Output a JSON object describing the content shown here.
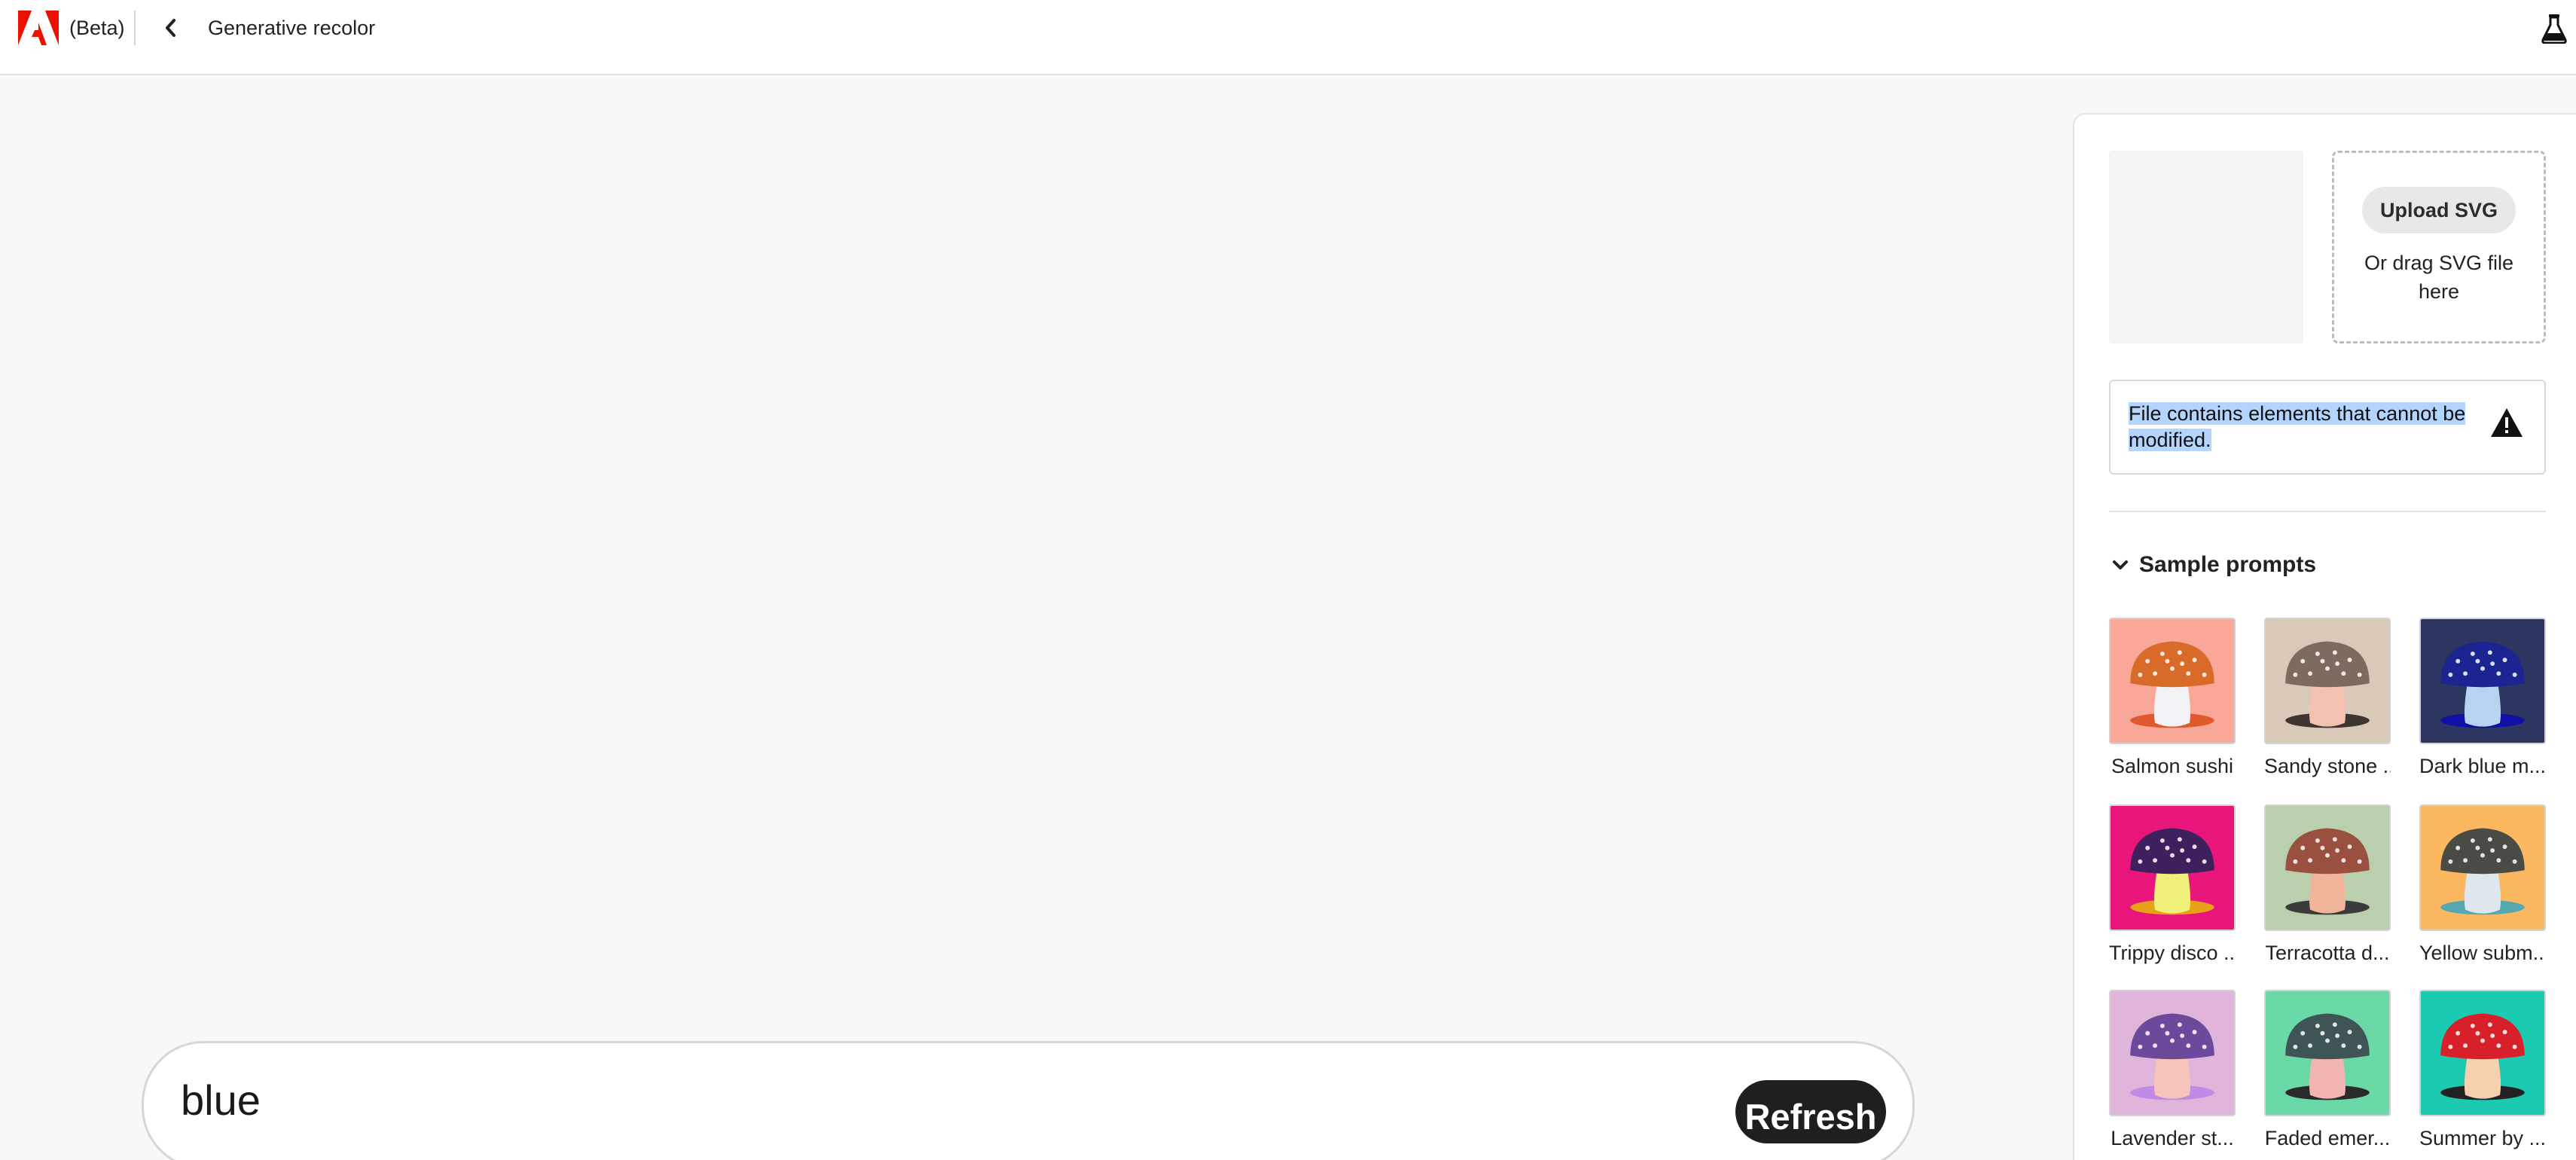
{
  "header": {
    "beta_label": "(Beta)",
    "title": "Generative recolor",
    "back_icon": "chevron-left-icon",
    "labs_icon": "flask-icon",
    "brand_color": "#eb1000"
  },
  "prompt": {
    "value": "blue",
    "refresh_label": "Refresh"
  },
  "panel": {
    "upload_label": "Upload SVG",
    "drag_text": "Or drag SVG file here",
    "alert_text": "File contains elements that cannot be modified.",
    "alert_icon": "warning-icon",
    "section_title": "Sample prompts",
    "samples": [
      {
        "label": "Salmon sushi",
        "bg": "#f9a799",
        "cap": "#d86a2a",
        "stem": "#f2f2f6",
        "shadow": "#e0592c"
      },
      {
        "label": "Sandy stone ...",
        "bg": "#d8c9b8",
        "cap": "#7d6b60",
        "stem": "#f4c1b0",
        "shadow": "#3e3430"
      },
      {
        "label": "Dark blue m...",
        "bg": "#2d3561",
        "cap": "#1b2490",
        "stem": "#b8d2f2",
        "shadow": "#1010a6"
      },
      {
        "label": "Trippy disco ...",
        "bg": "#e8167a",
        "cap": "#3e215c",
        "stem": "#eef07a",
        "shadow": "#e8a21a"
      },
      {
        "label": "Terracotta d...",
        "bg": "#b9cfae",
        "cap": "#9a503e",
        "stem": "#f0b49a",
        "shadow": "#3b3b3b"
      },
      {
        "label": "Yellow subm...",
        "bg": "#fbb861",
        "cap": "#4a4b44",
        "stem": "#dfe7ee",
        "shadow": "#55a7b0"
      },
      {
        "label": "Lavender st...",
        "bg": "#e0b5dc",
        "cap": "#6b4a9c",
        "stem": "#f6c4b8",
        "shadow": "#c08be6"
      },
      {
        "label": "Faded emer...",
        "bg": "#6bd8a8",
        "cap": "#3f5454",
        "stem": "#f1b5b0",
        "shadow": "#2a2a2a"
      },
      {
        "label": "Summer by ...",
        "bg": "#1cc9b1",
        "cap": "#d8202b",
        "stem": "#f7d0b0",
        "shadow": "#222"
      }
    ]
  }
}
